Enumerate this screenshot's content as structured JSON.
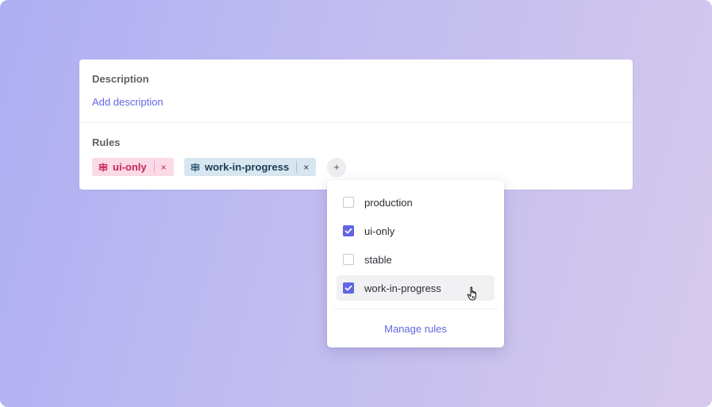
{
  "description": {
    "label": "Description",
    "add_link": "Add description"
  },
  "rules": {
    "label": "Rules",
    "chips": [
      {
        "label": "ui-only",
        "remove": "×",
        "color": "#c4245c",
        "bg": "#fbd9e6",
        "icon": "signpost-icon"
      },
      {
        "label": "work-in-progress",
        "remove": "×",
        "color": "#1b3d55",
        "bg": "#d7e6ef",
        "icon": "signpost-icon"
      }
    ],
    "add_button": "+"
  },
  "dropdown": {
    "options": [
      {
        "label": "production",
        "checked": false
      },
      {
        "label": "ui-only",
        "checked": true
      },
      {
        "label": "stable",
        "checked": false
      },
      {
        "label": "work-in-progress",
        "checked": true,
        "hovered": true
      }
    ],
    "manage_link": "Manage rules"
  },
  "colors": {
    "accent": "#6165e3",
    "link": "#6167e0"
  }
}
